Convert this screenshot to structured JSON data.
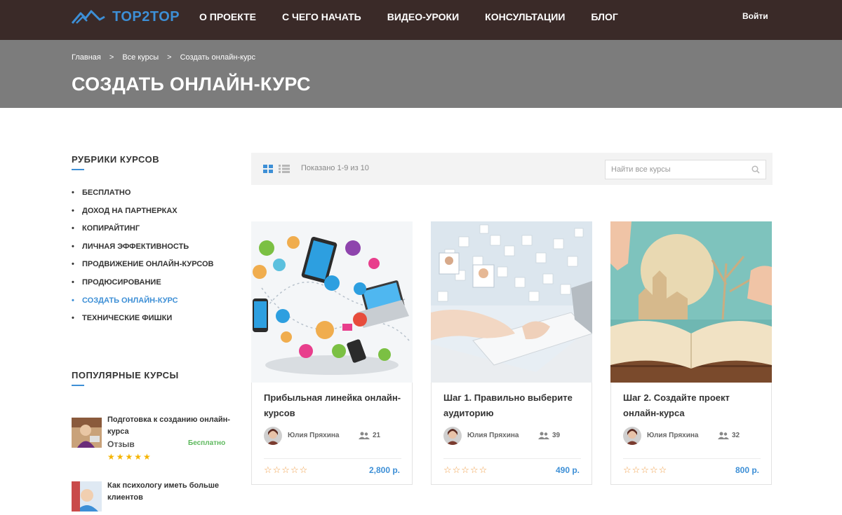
{
  "header": {
    "logo_text": "TOP2TOP",
    "nav": [
      "О ПРОЕКТЕ",
      "С ЧЕГО НАЧАТЬ",
      "ВИДЕО-УРОКИ",
      "КОНСУЛЬТАЦИИ",
      "БЛОГ"
    ],
    "login": "Войти"
  },
  "page": {
    "breadcrumb": [
      "Главная",
      "Все курсы",
      "Создать онлайн-курс"
    ],
    "breadcrumb_separator": ">",
    "title": "СОЗДАТЬ ОНЛАЙН-КУРС"
  },
  "sidebar": {
    "categories_heading": "РУБРИКИ КУРСОВ",
    "categories": [
      {
        "label": "БЕСПЛАТНО",
        "active": false
      },
      {
        "label": "ДОХОД НА ПАРТНЕРКАХ",
        "active": false
      },
      {
        "label": "КОПИРАЙТИНГ",
        "active": false
      },
      {
        "label": "ЛИЧНАЯ ЭФФЕКТИВНОСТЬ",
        "active": false
      },
      {
        "label": "ПРОДВИЖЕНИЕ ОНЛАЙН-КУРСОВ",
        "active": false
      },
      {
        "label": "ПРОДЮСИРОВАНИЕ",
        "active": false
      },
      {
        "label": "СОЗДАТЬ ОНЛАЙН-КУРС",
        "active": true
      },
      {
        "label": "ТЕХНИЧЕСКИЕ ФИШКИ",
        "active": false
      }
    ],
    "popular_heading": "ПОПУЛЯРНЫЕ КУРСЫ",
    "popular": [
      {
        "title": "Подготовка к созданию онлайн-курса",
        "meta": "Отзыв",
        "price": "Бесплатно",
        "stars": "★★★★★"
      },
      {
        "title": "Как психологу иметь больше клиентов",
        "meta": "",
        "price": "",
        "stars": ""
      }
    ]
  },
  "toolbar": {
    "shown_text": "Показано 1-9 из 10",
    "search_placeholder": "Найти все курсы"
  },
  "courses": [
    {
      "title": "Прибыльная линейка онлайн-курсов",
      "author": "Юлия Пряхина",
      "students": "21",
      "rating": "☆☆☆☆☆",
      "price": "2,800 р."
    },
    {
      "title": "Шаг 1. Правильно выберите аудиторию",
      "author": "Юлия Пряхина",
      "students": "39",
      "rating": "☆☆☆☆☆",
      "price": "490 р."
    },
    {
      "title": "Шаг 2. Создайте проект онлайн-курса",
      "author": "Юлия Пряхина",
      "students": "32",
      "rating": "☆☆☆☆☆",
      "price": "800 р."
    }
  ],
  "colors": {
    "topbar": "#3a2a28",
    "pagehead": "#7c7c7c",
    "accent": "#3d8fd6",
    "free": "#5cb85c",
    "star": "#f5b400"
  }
}
